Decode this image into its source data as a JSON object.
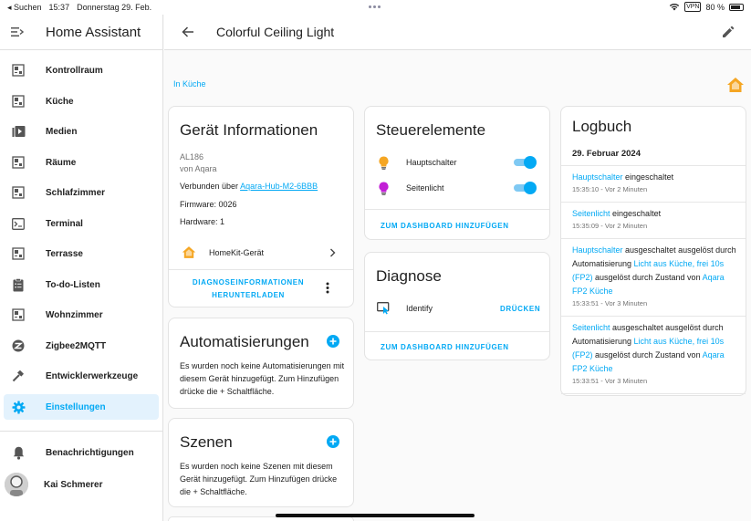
{
  "status_bar": {
    "back_label": "◂ Suchen",
    "time": "15:37",
    "date": "Donnerstag 29. Feb.",
    "vpn": "VPN",
    "battery": "80 %"
  },
  "sidebar": {
    "app_title": "Home Assistant",
    "items": [
      {
        "label": "Kontrollraum",
        "icon": "dashboard-grid-icon"
      },
      {
        "label": "Küche",
        "icon": "dashboard-grid-icon"
      },
      {
        "label": "Medien",
        "icon": "media-play-icon"
      },
      {
        "label": "Räume",
        "icon": "dashboard-grid-icon"
      },
      {
        "label": "Schlafzimmer",
        "icon": "dashboard-grid-icon"
      },
      {
        "label": "Terminal",
        "icon": "terminal-icon"
      },
      {
        "label": "Terrasse",
        "icon": "dashboard-grid-icon"
      },
      {
        "label": "To-do-Listen",
        "icon": "clipboard-list-icon"
      },
      {
        "label": "Wohnzimmer",
        "icon": "dashboard-grid-icon"
      },
      {
        "label": "Zigbee2MQTT",
        "icon": "zigbee-icon"
      },
      {
        "label": "Entwicklerwerkzeuge",
        "icon": "hammer-icon"
      },
      {
        "label": "Einstellungen",
        "icon": "gear-icon"
      }
    ],
    "notifications": "Benachrichtigungen",
    "user": "Kai Schmerer"
  },
  "header": {
    "title": "Colorful Ceiling Light"
  },
  "area_link": "In Küche",
  "device_info": {
    "title": "Gerät Informationen",
    "model": "AL186",
    "manufacturer": "von Aqara",
    "connected_via_label": "Verbunden über",
    "connected_via_link": "Aqara-Hub-M2-6BBB",
    "firmware": "Firmware: 0026",
    "hardware": "Hardware: 1",
    "integration": "HomeKit-Gerät",
    "download_line1": "DIAGNOSEINFORMATIONEN",
    "download_line2": "HERUNTERLADEN"
  },
  "automations": {
    "title": "Automatisierungen",
    "text": "Es wurden noch keine Automatisierungen mit diesem Gerät hinzugefügt. Zum Hinzufügen drücke die + Schaltfläche."
  },
  "scenes": {
    "title": "Szenen",
    "text": "Es wurden noch keine Szenen mit diesem Gerät hinzugefügt. Zum Hinzufügen drücke die + Schaltfläche."
  },
  "controls": {
    "title": "Steuerelemente",
    "entities": [
      {
        "name": "Hauptschalter",
        "state": "on",
        "icon_color": "#f5a623"
      },
      {
        "name": "Seitenlicht",
        "state": "on",
        "icon_color": "#c21fd6"
      }
    ],
    "add_button": "ZUM DASHBOARD HINZUFÜGEN"
  },
  "diagnostics": {
    "title": "Diagnose",
    "entity": "Identify",
    "action": "DRÜCKEN",
    "add_button": "ZUM DASHBOARD HINZUFÜGEN"
  },
  "logbook": {
    "title": "Logbuch",
    "date": "29. Februar 2024",
    "entries": [
      {
        "entity": "Hauptschalter",
        "text": " eingeschaltet",
        "time": "15:35:10 - Vor 2 Minuten"
      },
      {
        "entity": "Seitenlicht",
        "text": " eingeschaltet",
        "time": "15:35:09 - Vor 2 Minuten"
      },
      {
        "entity": "Hauptschalter",
        "text": " ausgeschaltet ausgelöst durch Automatisierung ",
        "auto": "Licht aus Küche, frei 10s (FP2)",
        "text2": " ausgelöst durch Zustand von ",
        "src": "Aqara FP2 Küche",
        "time": "15:33:51 - Vor 3 Minuten"
      },
      {
        "entity": "Seitenlicht",
        "text": " ausgeschaltet ausgelöst durch Automatisierung ",
        "auto": "Licht aus Küche, frei 10s (FP2)",
        "text2": " ausgelöst durch Zustand von ",
        "src": "Aqara FP2 Küche",
        "time": "15:33:51 - Vor 3 Minuten"
      }
    ]
  },
  "colors": {
    "accent": "#03a9f4",
    "home_icon": "#f5a623"
  }
}
